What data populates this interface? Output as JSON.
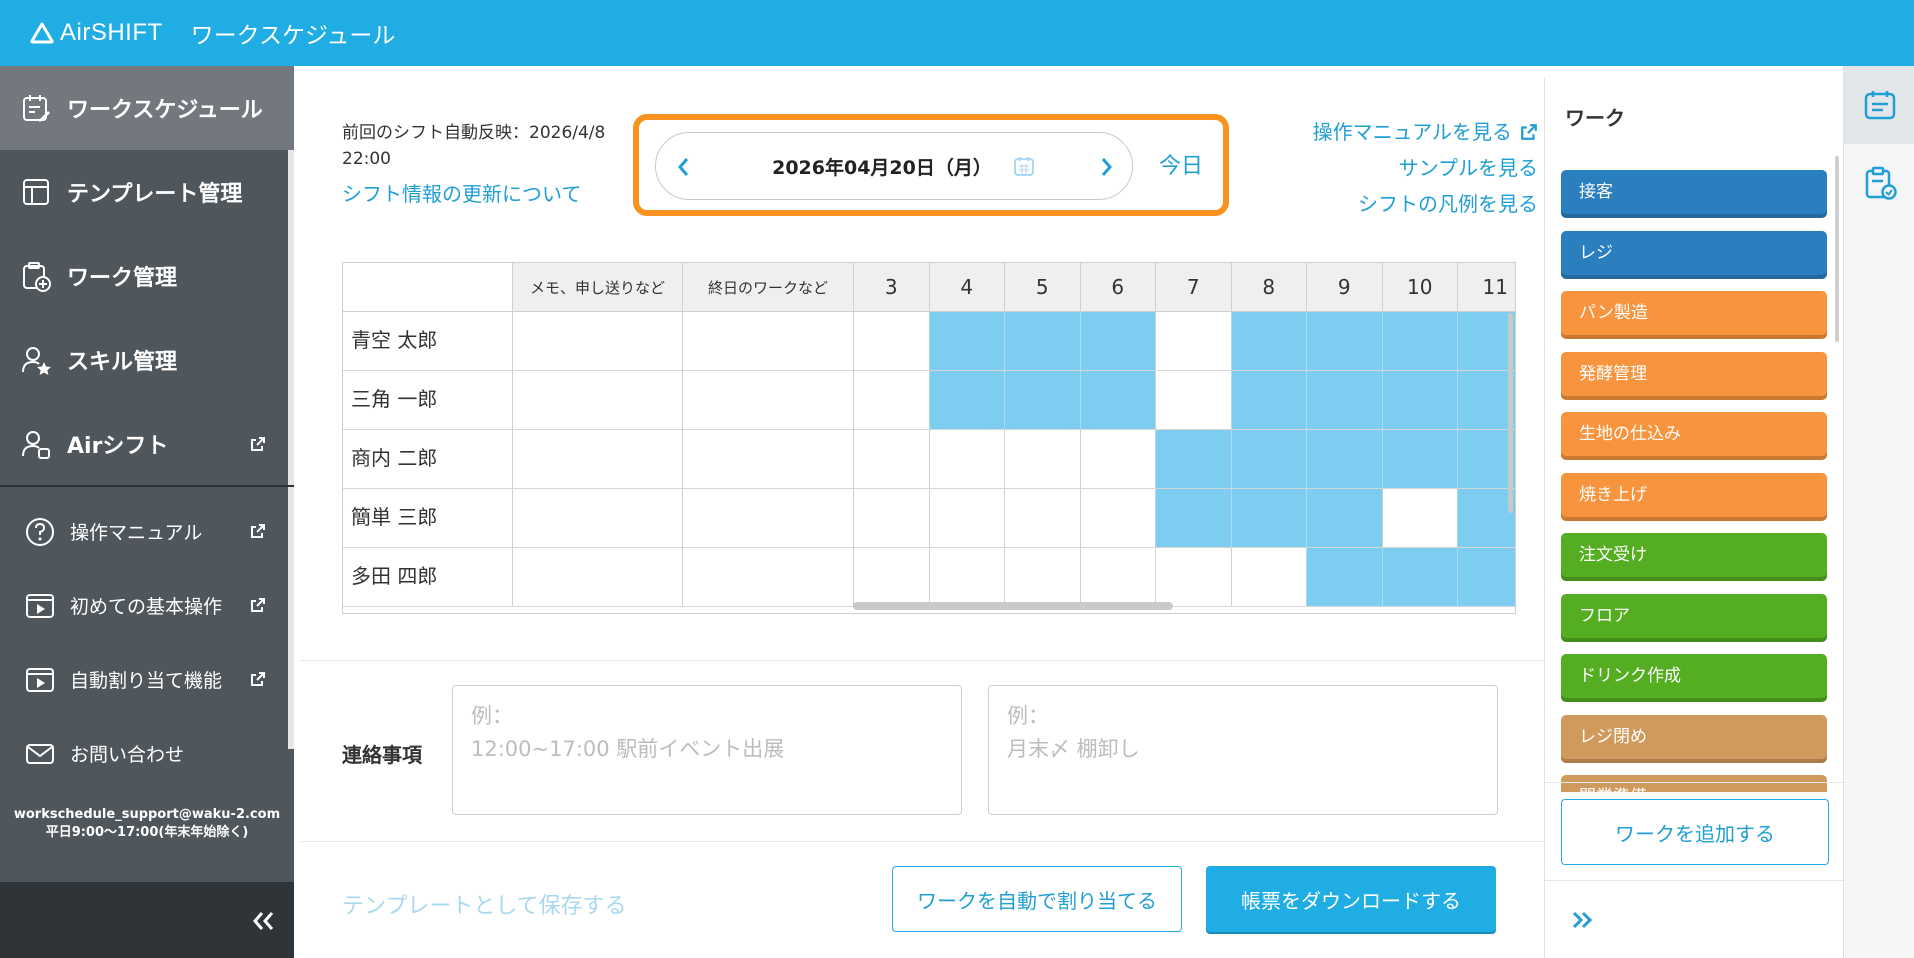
{
  "app": {
    "brand": "AirSHIFT",
    "title": "ワークスケジュール"
  },
  "sidebar": {
    "nav": [
      {
        "label": "ワークスケジュール",
        "icon": "schedule-edit-icon",
        "active": true
      },
      {
        "label": "テンプレート管理",
        "icon": "template-icon"
      },
      {
        "label": "ワーク管理",
        "icon": "work-add-icon"
      },
      {
        "label": "スキル管理",
        "icon": "skill-user-icon"
      },
      {
        "label": "Airシフト",
        "icon": "airshift-user-icon",
        "external": true
      }
    ],
    "sub": [
      {
        "label": "操作マニュアル",
        "icon": "help-circle-icon",
        "external": true
      },
      {
        "label": "初めての基本操作",
        "icon": "video-play-icon",
        "external": true
      },
      {
        "label": "自動割り当て機能",
        "icon": "video-play-icon",
        "external": true
      },
      {
        "label": "お問い合わせ",
        "icon": "mail-icon"
      }
    ],
    "support_email": "workschedule_support@waku-2.com",
    "support_hours": "平日9:00〜17:00(年末年始除く)"
  },
  "main": {
    "sync_label": "前回のシフト自動反映：2026/4/8",
    "sync_time": "22:00",
    "sync_link": "シフト情報の更新について",
    "date": "2026年04月20日（月）",
    "today": "今日",
    "links": [
      "操作マニュアルを見る",
      "サンプルを見る",
      "シフトの凡例を見る"
    ]
  },
  "grid": {
    "headers": {
      "memo": "メモ、申し送りなど",
      "allday": "終日のワークなど"
    },
    "hours": [
      "3",
      "4",
      "5",
      "6",
      "7",
      "8",
      "9",
      "10",
      "11"
    ],
    "rows": [
      {
        "name": "青空 太郎",
        "filled": [
          false,
          true,
          true,
          true,
          false,
          true,
          true,
          true,
          true
        ]
      },
      {
        "name": "三角 一郎",
        "filled": [
          false,
          true,
          true,
          true,
          false,
          true,
          true,
          true,
          true
        ]
      },
      {
        "name": "商内 二郎",
        "filled": [
          false,
          false,
          false,
          false,
          true,
          true,
          true,
          true,
          true
        ]
      },
      {
        "name": "簡単 三郎",
        "filled": [
          false,
          false,
          false,
          false,
          true,
          true,
          true,
          false,
          true
        ]
      },
      {
        "name": "多田 四郎",
        "filled": [
          false,
          false,
          false,
          false,
          false,
          false,
          true,
          true,
          true
        ]
      }
    ],
    "fill_color": "#7dcdf0"
  },
  "notes": {
    "label": "連絡事項",
    "placeholder1": "例：\n12:00~17:00 駅前イベント出展",
    "placeholder2": "例：\n月末〆 棚卸し"
  },
  "footer": {
    "save_template": "テンプレートとして保存する",
    "auto_assign": "ワークを自動で割り当てる",
    "download": "帳票をダウンロードする"
  },
  "work_panel": {
    "title": "ワーク",
    "items": [
      {
        "label": "接客",
        "color": "#2c7fbf"
      },
      {
        "label": "レジ",
        "color": "#2c7fbf"
      },
      {
        "label": "パン製造",
        "color": "#f7943d"
      },
      {
        "label": "発酵管理",
        "color": "#f7943d"
      },
      {
        "label": "生地の仕込み",
        "color": "#f7943d"
      },
      {
        "label": "焼き上げ",
        "color": "#f7943d"
      },
      {
        "label": "注文受け",
        "color": "#55ad22"
      },
      {
        "label": "フロア",
        "color": "#55ad22"
      },
      {
        "label": "ドリンク作成",
        "color": "#55ad22"
      },
      {
        "label": "レジ閉め",
        "color": "#d09a5c"
      },
      {
        "label": "開業準備",
        "color": "#d09a5c"
      }
    ],
    "add_button": "ワークを追加する"
  },
  "colors": {
    "brand": "#1fade3",
    "accent_orange": "#f7931e",
    "sidebar": "#4f565c"
  }
}
